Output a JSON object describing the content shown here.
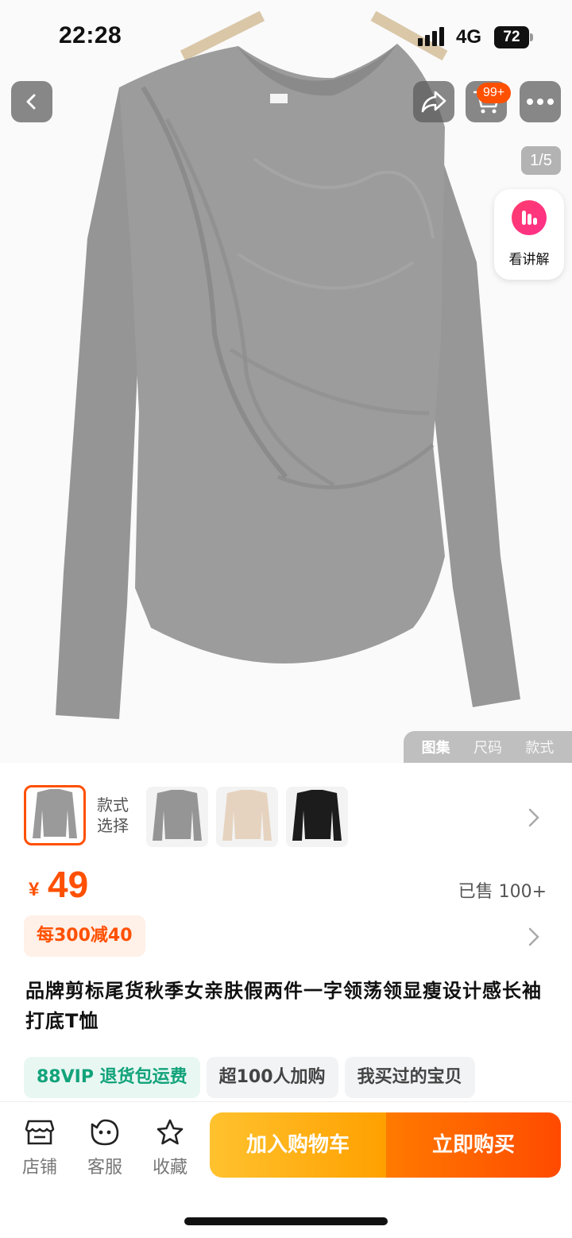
{
  "status_bar": {
    "time": "22:28",
    "network": "4G",
    "battery": "72"
  },
  "nav": {
    "cart_badge": "99+"
  },
  "gallery": {
    "page_indicator": "1/5",
    "explain_label": "看讲解",
    "tabs": [
      "图集",
      "尺码",
      "款式"
    ],
    "active_tab": 0
  },
  "styles": {
    "label_line1": "款式",
    "label_line2": "选择",
    "swatches": [
      "gray",
      "gray",
      "beige",
      "black"
    ]
  },
  "price": {
    "currency": "¥",
    "value": "49",
    "sold": "已售 100+"
  },
  "promo": {
    "text": "每300减40"
  },
  "product": {
    "title": "品牌剪标尾货秋季女亲肤假两件一字领荡领显瘦设计感长袖打底T恤"
  },
  "tags": [
    "88VIP 退货包运费",
    "超100人加购",
    "我买过的宝贝"
  ],
  "bottom": {
    "shop": "店铺",
    "service": "客服",
    "favorite": "收藏",
    "add_to_cart": "加入购物车",
    "buy_now": "立即购买"
  },
  "colors": {
    "accent": "#ff5000",
    "vip_green": "#12a37a",
    "shirt_gray": "#999999"
  }
}
